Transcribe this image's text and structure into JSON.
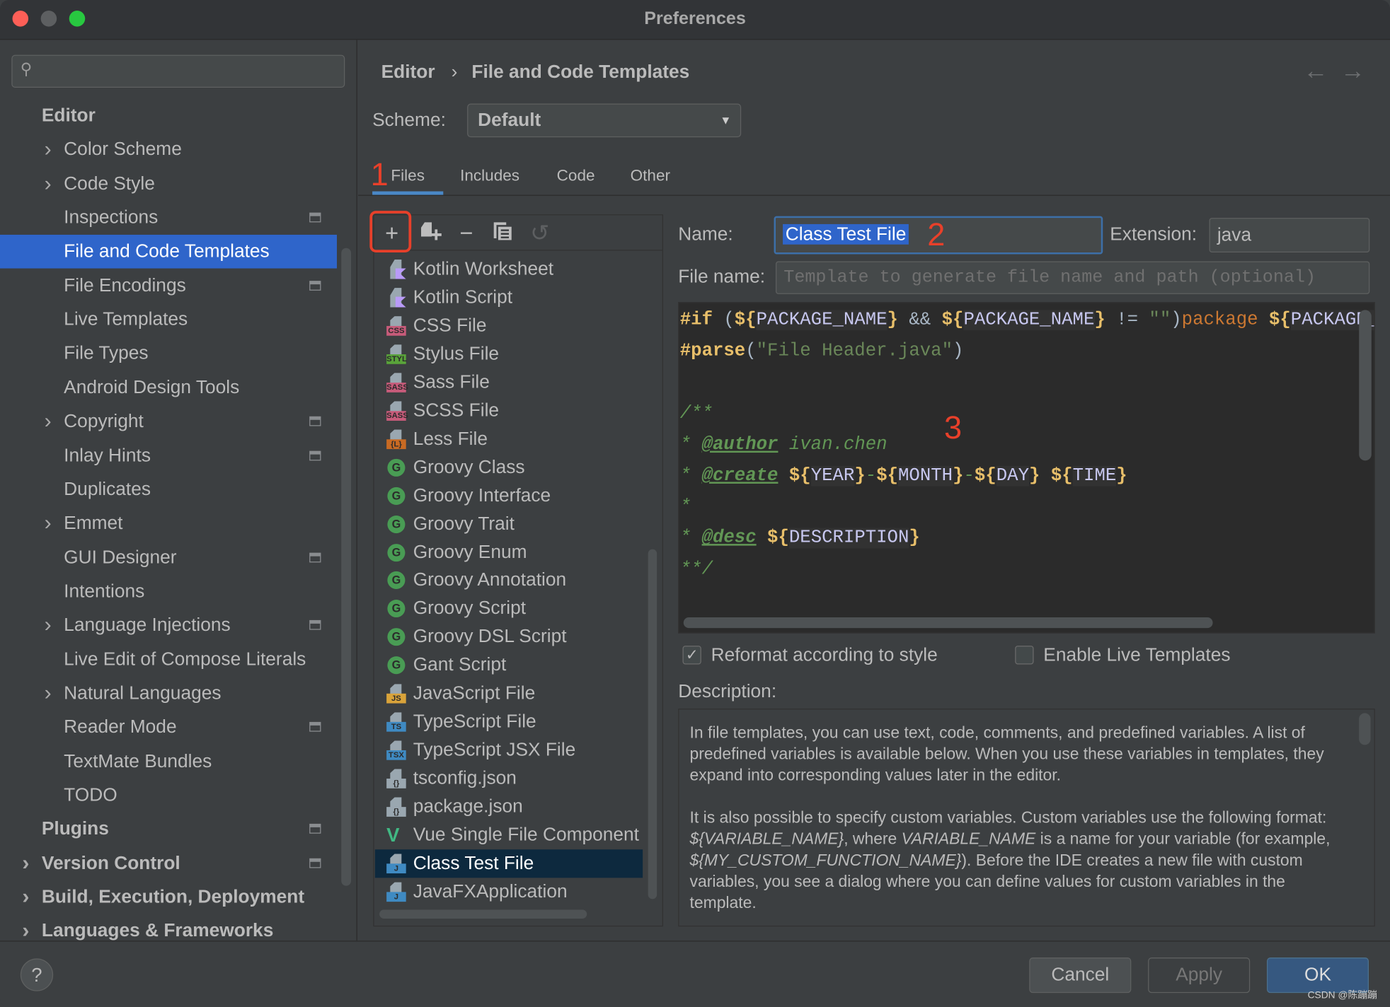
{
  "window": {
    "title": "Preferences"
  },
  "search": {
    "placeholder": ""
  },
  "sidebar": {
    "items": [
      {
        "label": "Editor",
        "indent": 0,
        "chevron": false,
        "proj": false,
        "bold": true
      },
      {
        "label": "Color Scheme",
        "indent": 1,
        "chevron": true,
        "proj": false
      },
      {
        "label": "Code Style",
        "indent": 1,
        "chevron": true,
        "proj": false
      },
      {
        "label": "Inspections",
        "indent": 1,
        "chevron": false,
        "proj": true
      },
      {
        "label": "File and Code Templates",
        "indent": 1,
        "chevron": false,
        "proj": false,
        "selected": true
      },
      {
        "label": "File Encodings",
        "indent": 1,
        "chevron": false,
        "proj": true
      },
      {
        "label": "Live Templates",
        "indent": 1,
        "chevron": false,
        "proj": false
      },
      {
        "label": "File Types",
        "indent": 1,
        "chevron": false,
        "proj": false
      },
      {
        "label": "Android Design Tools",
        "indent": 1,
        "chevron": false,
        "proj": false
      },
      {
        "label": "Copyright",
        "indent": 1,
        "chevron": true,
        "proj": true
      },
      {
        "label": "Inlay Hints",
        "indent": 1,
        "chevron": false,
        "proj": true
      },
      {
        "label": "Duplicates",
        "indent": 1,
        "chevron": false,
        "proj": false
      },
      {
        "label": "Emmet",
        "indent": 1,
        "chevron": true,
        "proj": false
      },
      {
        "label": "GUI Designer",
        "indent": 1,
        "chevron": false,
        "proj": true
      },
      {
        "label": "Intentions",
        "indent": 1,
        "chevron": false,
        "proj": false
      },
      {
        "label": "Language Injections",
        "indent": 1,
        "chevron": true,
        "proj": true
      },
      {
        "label": "Live Edit of Compose Literals",
        "indent": 1,
        "chevron": false,
        "proj": false
      },
      {
        "label": "Natural Languages",
        "indent": 1,
        "chevron": true,
        "proj": false
      },
      {
        "label": "Reader Mode",
        "indent": 1,
        "chevron": false,
        "proj": true
      },
      {
        "label": "TextMate Bundles",
        "indent": 1,
        "chevron": false,
        "proj": false
      },
      {
        "label": "TODO",
        "indent": 1,
        "chevron": false,
        "proj": false
      },
      {
        "label": "Plugins",
        "indent": 0,
        "chevron": false,
        "proj": true,
        "bold": true
      },
      {
        "label": "Version Control",
        "indent": 0,
        "chevron": true,
        "proj": true,
        "bold": true
      },
      {
        "label": "Build, Execution, Deployment",
        "indent": 0,
        "chevron": true,
        "proj": false,
        "bold": true
      },
      {
        "label": "Languages & Frameworks",
        "indent": 0,
        "chevron": true,
        "proj": false,
        "bold": true
      }
    ]
  },
  "breadcrumb": {
    "parent": "Editor",
    "separator": "›",
    "current": "File and Code Templates",
    "back_icon": "←",
    "forward_icon": "→"
  },
  "scheme": {
    "label": "Scheme:",
    "value": "Default"
  },
  "tabs": [
    {
      "label": "Files",
      "active": true
    },
    {
      "label": "Includes"
    },
    {
      "label": "Code"
    },
    {
      "label": "Other"
    }
  ],
  "annotations": {
    "a1": "1",
    "a2": "2",
    "a3": "3"
  },
  "list_toolbar": {
    "add": "+",
    "add_child": "add-child-template",
    "remove": "−",
    "copy": "copy",
    "reset": "↺"
  },
  "templates": [
    {
      "label": "Kotlin Worksheet",
      "icon": "kotlin"
    },
    {
      "label": "Kotlin Script",
      "icon": "kotlin"
    },
    {
      "label": "CSS File",
      "icon": "badge",
      "badge": "CSS",
      "color": "#c75b7a"
    },
    {
      "label": "Stylus File",
      "icon": "badge",
      "badge": "STYL",
      "color": "#59a33a"
    },
    {
      "label": "Sass File",
      "icon": "badge",
      "badge": "SASS",
      "color": "#c75b7a"
    },
    {
      "label": "SCSS File",
      "icon": "badge",
      "badge": "SASS",
      "color": "#c75b7a"
    },
    {
      "label": "Less File",
      "icon": "badge",
      "badge": "{L}",
      "color": "#c86a23"
    },
    {
      "label": "Groovy Class",
      "icon": "groovy"
    },
    {
      "label": "Groovy Interface",
      "icon": "groovy"
    },
    {
      "label": "Groovy Trait",
      "icon": "groovy"
    },
    {
      "label": "Groovy Enum",
      "icon": "groovy"
    },
    {
      "label": "Groovy Annotation",
      "icon": "groovy"
    },
    {
      "label": "Groovy Script",
      "icon": "groovy"
    },
    {
      "label": "Groovy DSL Script",
      "icon": "groovy"
    },
    {
      "label": "Gant Script",
      "icon": "groovy"
    },
    {
      "label": "JavaScript File",
      "icon": "badge",
      "badge": "JS",
      "color": "#d9a33a"
    },
    {
      "label": "TypeScript File",
      "icon": "badge",
      "badge": "TS",
      "color": "#3f8ac2"
    },
    {
      "label": "TypeScript JSX File",
      "icon": "badge",
      "badge": "TSX",
      "color": "#3f8ac2"
    },
    {
      "label": "tsconfig.json",
      "icon": "badge",
      "badge": "{}",
      "color": "#9aa7b0"
    },
    {
      "label": "package.json",
      "icon": "badge",
      "badge": "{}",
      "color": "#9aa7b0"
    },
    {
      "label": "Vue Single File Component",
      "icon": "vue"
    },
    {
      "label": "Class Test File",
      "icon": "badge",
      "badge": "J",
      "color": "#3f8ac2",
      "selected": true
    },
    {
      "label": "JavaFXApplication",
      "icon": "badge",
      "badge": "J",
      "color": "#3f8ac2"
    }
  ],
  "form": {
    "name_label": "Name:",
    "name_value": "Class Test File",
    "extension_label": "Extension:",
    "extension_value": "java",
    "filename_label": "File name:",
    "filename_placeholder": "Template to generate file name and path (optional)",
    "reformat_label": "Reformat according to style",
    "reformat_checked": true,
    "live_label": "Enable Live Templates",
    "live_checked": false,
    "description_label": "Description:"
  },
  "code": {
    "lines": [
      [
        {
          "t": "#if",
          "c": "dir"
        },
        {
          "t": " (",
          "c": "op"
        },
        {
          "t": "${",
          "c": "var"
        },
        {
          "t": "PACKAGE_NAME",
          "c": "vn"
        },
        {
          "t": "}",
          "c": "var"
        },
        {
          "t": " && ",
          "c": "op"
        },
        {
          "t": "${",
          "c": "var"
        },
        {
          "t": "PACKAGE_NAME",
          "c": "vn"
        },
        {
          "t": "}",
          "c": "var"
        },
        {
          "t": " != ",
          "c": "op"
        },
        {
          "t": "\"\"",
          "c": "str"
        },
        {
          "t": ")",
          "c": "op"
        },
        {
          "t": "package",
          "c": "kw"
        },
        {
          "t": " ",
          "c": "op"
        },
        {
          "t": "${",
          "c": "var"
        },
        {
          "t": "PACKAGE_NAME",
          "c": "vn"
        },
        {
          "t": "};",
          "c": "var"
        }
      ],
      [
        {
          "t": "#parse",
          "c": "dir"
        },
        {
          "t": "(",
          "c": "op"
        },
        {
          "t": "\"File Header.java\"",
          "c": "str"
        },
        {
          "t": ")",
          "c": "op"
        }
      ],
      [],
      [
        {
          "t": "/**",
          "c": "cm"
        }
      ],
      [
        {
          "t": "* ",
          "c": "cm"
        },
        {
          "t": "@author",
          "c": "tag"
        },
        {
          "t": " ivan.chen",
          "c": "cm"
        }
      ],
      [
        {
          "t": "* ",
          "c": "cm"
        },
        {
          "t": "@create",
          "c": "tag"
        },
        {
          "t": " ",
          "c": "cm"
        },
        {
          "t": "${",
          "c": "var"
        },
        {
          "t": "YEAR",
          "c": "vn"
        },
        {
          "t": "}",
          "c": "var"
        },
        {
          "t": "-",
          "c": "cm"
        },
        {
          "t": "${",
          "c": "var"
        },
        {
          "t": "MONTH",
          "c": "vn"
        },
        {
          "t": "}",
          "c": "var"
        },
        {
          "t": "-",
          "c": "cm"
        },
        {
          "t": "${",
          "c": "var"
        },
        {
          "t": "DAY",
          "c": "vn"
        },
        {
          "t": "}",
          "c": "var"
        },
        {
          "t": " ",
          "c": "cm"
        },
        {
          "t": "${",
          "c": "var"
        },
        {
          "t": "TIME",
          "c": "vn"
        },
        {
          "t": "}",
          "c": "var"
        }
      ],
      [
        {
          "t": "*",
          "c": "cm"
        }
      ],
      [
        {
          "t": "* ",
          "c": "cm"
        },
        {
          "t": "@desc",
          "c": "tag"
        },
        {
          "t": " ",
          "c": "cm"
        },
        {
          "t": "${",
          "c": "var"
        },
        {
          "t": "DESCRIPTION",
          "c": "vn"
        },
        {
          "t": "}",
          "c": "var"
        }
      ],
      [
        {
          "t": "**/",
          "c": "cm"
        }
      ]
    ]
  },
  "description": {
    "p1": "In file templates, you can use text, code, comments, and predefined variables. A list of predefined variables is available below. When you use these variables in templates, they expand into corresponding values later in the editor.",
    "p2": [
      {
        "t": "It is also possible to specify custom variables. Custom variables use the following format: "
      },
      {
        "t": "${VARIABLE_NAME}",
        "i": true
      },
      {
        "t": ", where "
      },
      {
        "t": "VARIABLE_NAME",
        "i": true
      },
      {
        "t": " is a name for your variable (for example, "
      },
      {
        "t": "${MY_CUSTOM_FUNCTION_NAME}",
        "i": true
      },
      {
        "t": "). Before the IDE creates a new file with custom variables, you see a dialog where you can define values for custom variables in the template."
      }
    ]
  },
  "buttons": {
    "help": "?",
    "cancel": "Cancel",
    "apply": "Apply",
    "ok": "OK"
  },
  "watermark": "CSDN @陈蹦蹦",
  "colors": {
    "accent": "#2f65ca",
    "selection": "#0d293e",
    "annotation": "#e8402a",
    "ok": "#365880"
  }
}
